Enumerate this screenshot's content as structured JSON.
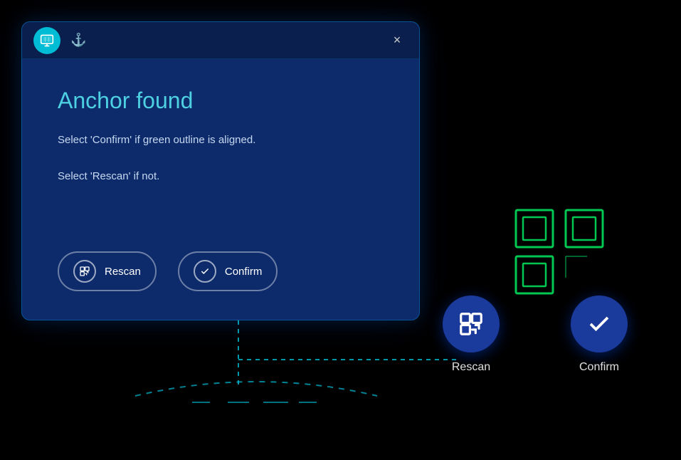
{
  "window": {
    "title_icon": "screen-icon",
    "anchor_icon": "anchor-icon",
    "close_label": "×",
    "heading": "Anchor found",
    "instruction_1": "Select 'Confirm' if green outline is aligned.",
    "instruction_2": "Select 'Rescan' if not.",
    "rescan_label": "Rescan",
    "confirm_label": "Confirm"
  },
  "actions_3d": {
    "rescan_label": "Rescan",
    "confirm_label": "Confirm"
  },
  "colors": {
    "background": "#000000",
    "panel_bg": "#0d2b6b",
    "titlebar_bg": "#0a1f4e",
    "accent_cyan": "#00bcd4",
    "accent_green": "#00c853",
    "heading_color": "#4dd0e1",
    "text_color": "#c5d8f0",
    "button_border": "rgba(255,255,255,0.4)",
    "large_btn_bg": "#1a3a9c"
  }
}
